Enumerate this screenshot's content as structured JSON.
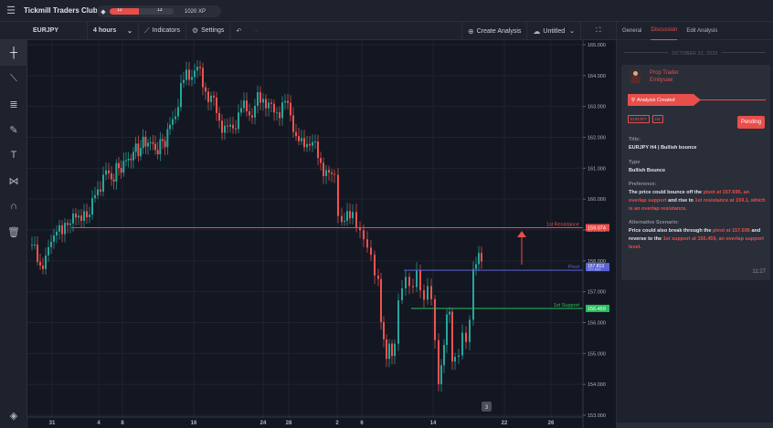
{
  "header": {
    "title": "Tickmill Traders Club",
    "xp": {
      "level_current": "12",
      "level_next": "13",
      "progress": 0.45,
      "xp_text": "1020 XP"
    }
  },
  "toolbar": {
    "symbol": "EURJPY",
    "timeframe": "4 hours",
    "indicators": "Indicators",
    "settings": "Settings",
    "create_analysis": "Create Analysis",
    "layout_name": "Untitled"
  },
  "left_tools": [
    "crosshair-icon",
    "trend-line-icon",
    "fib-lines-icon",
    "brush-icon",
    "text-icon",
    "pattern-icon",
    "magnet-icon",
    "trash-icon"
  ],
  "chart": {
    "price_labels": [
      "165.000",
      "164.000",
      "163.000",
      "162.000",
      "161.000",
      "160.000",
      "159.000",
      "158.000",
      "157.000",
      "156.000",
      "155.000",
      "154.000",
      "153.000"
    ],
    "date_labels": [
      "31",
      "4",
      "8",
      "16",
      "24",
      "28",
      "2",
      "6",
      "14",
      "22",
      "26"
    ],
    "levels": {
      "resistance": {
        "label": "1st Resistance",
        "price": "159.074",
        "color": "#e84e4a"
      },
      "pivot": {
        "label": "Pivot",
        "price": "157.813",
        "price2": "157.695",
        "color": "#5b62d6"
      },
      "support": {
        "label": "1st Support",
        "price": "156.459",
        "color": "#26c05c"
      }
    },
    "right_marker": "3"
  },
  "panel": {
    "tabs": [
      "General",
      "Discussion",
      "Edit Analysis"
    ],
    "active_tab": "Discussion",
    "date": "OCTOBER 22, 2022",
    "author_role": "Prop Trader",
    "author_name": "Emilysaw",
    "created": "Analysis Created",
    "tags": [
      "EURJPY",
      "H4"
    ],
    "status": "Pending",
    "title_label": "Title:",
    "title_value": "EURJPY H4 | Bullish bounce",
    "type_label": "Type",
    "type_value": "Bullish Bounce",
    "pref_label": "Preference:",
    "pref_1": "The price could bounce off the ",
    "pref_2": "pivot at 157.695, an overlap support",
    "pref_3": " and rise to ",
    "pref_4": "1st resistance at 159.1, which is an overlap resistance.",
    "alt_label": "Alternative Scenario:",
    "alt_1": "Price could also break through the ",
    "alt_2": "pivot at 157.695",
    "alt_3": " and reverse to the ",
    "alt_4": "1st support at 156.459, an overlap support level.",
    "time": "11:27"
  },
  "colors": {
    "up": "#26a69a",
    "down": "#ef5350",
    "accent": "#e84e4a"
  }
}
